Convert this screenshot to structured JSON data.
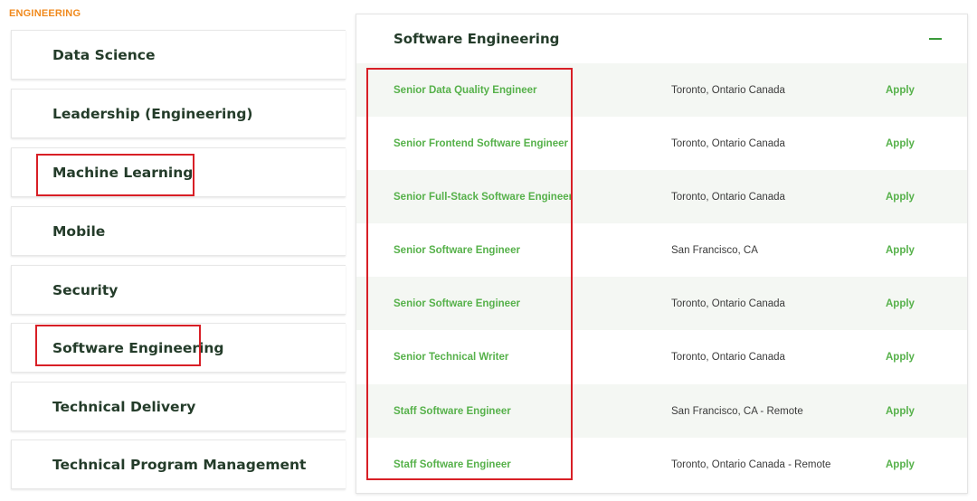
{
  "section_label": "ENGINEERING",
  "categories": [
    {
      "label": "Data Science"
    },
    {
      "label": "Leadership (Engineering)"
    },
    {
      "label": "Machine Learning"
    },
    {
      "label": "Mobile"
    },
    {
      "label": "Security"
    },
    {
      "label": "Software Engineering"
    },
    {
      "label": "Technical Delivery"
    },
    {
      "label": "Technical Program Management"
    }
  ],
  "panel": {
    "title": "Software Engineering",
    "collapse_symbol": "—",
    "jobs": [
      {
        "title": "Senior Data Quality Engineer",
        "location": "Toronto, Ontario Canada",
        "apply": "Apply"
      },
      {
        "title": "Senior Frontend Software Engineer",
        "location": "Toronto, Ontario Canada",
        "apply": "Apply"
      },
      {
        "title": "Senior Full-Stack Software Engineer",
        "location": "Toronto, Ontario Canada",
        "apply": "Apply"
      },
      {
        "title": "Senior Software Engineer",
        "location": "San Francisco, CA",
        "apply": "Apply"
      },
      {
        "title": "Senior Software Engineer",
        "location": "Toronto, Ontario Canada",
        "apply": "Apply"
      },
      {
        "title": "Senior Technical Writer",
        "location": "Toronto, Ontario Canada",
        "apply": "Apply"
      },
      {
        "title": "Staff Software Engineer",
        "location": "San Francisco, CA - Remote",
        "apply": "Apply"
      },
      {
        "title": "Staff Software Engineer",
        "location": "Toronto, Ontario Canada - Remote",
        "apply": "Apply"
      }
    ]
  },
  "colors": {
    "section_label": "#f0891c",
    "heading_text": "#243c2a",
    "job_link": "#56b14a",
    "row_alt_bg": "#f4f7f3",
    "highlight_box": "#d81f26"
  }
}
